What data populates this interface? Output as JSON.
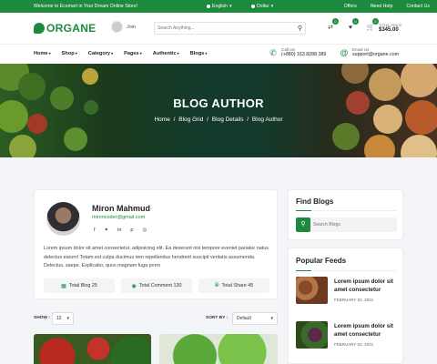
{
  "topbar": {
    "welcome": "Welcome to Ecomart in Your Dream Online Store!",
    "language": "English",
    "currency": "Dollar",
    "links": [
      "Offers",
      "Need Help",
      "Contact Us"
    ]
  },
  "header": {
    "logo": "ORGANE",
    "join": "Join",
    "search_placeholder": "Search Anything...",
    "icons": [
      {
        "name": "compare-icon",
        "badge": "0"
      },
      {
        "name": "wishlist-icon",
        "badge": "0"
      },
      {
        "name": "cart-icon",
        "badge": "0"
      }
    ],
    "total_label": "TOTAL PRICE",
    "total_value": "$345.00"
  },
  "nav": {
    "items": [
      "Home",
      "Shop",
      "Category",
      "Pages",
      "Authentic",
      "Blogs"
    ],
    "call_label": "Call Us",
    "call_value": "(+880) 163 8288 389",
    "email_label": "Email Us",
    "email_value": "support@organe.com"
  },
  "hero": {
    "title": "BLOG AUTHOR",
    "breadcrumb": [
      "Home",
      "Blog Grid",
      "Blog Details",
      "Blog Author"
    ]
  },
  "author": {
    "name": "Miron Mahmud",
    "email": "mironcoder@gmail.com",
    "social": [
      "facebook-icon",
      "twitter-icon",
      "linkedin-icon",
      "pinterest-icon",
      "instagram-icon"
    ],
    "bio": "Lorem ipsum dolor sit amet consectetur, adipisicing elit. Ea deserunt nisi tempore eveniet pariatur natus delectus earum! Totam est culpa ducimus rem repellendus hendrerit suscipit veritatis assumenda. Delectus, saepe. Explicabo, quos magnam fuga porro",
    "stats": [
      "Total Blog 25",
      "Total Comment 130",
      "Total Share 45"
    ]
  },
  "sidebar": {
    "find_title": "Find Blogs",
    "search_placeholder": "Search Blogs",
    "popular_title": "Popular Feeds",
    "feeds": [
      {
        "title": "Lorem ipsum dolor sit amet consectetur",
        "date": "FEBRUARY 02, 2021"
      },
      {
        "title": "Lorem ipsum dolor sit amet consectetur",
        "date": "FEBRUARY 02, 2021"
      }
    ]
  },
  "listing": {
    "show_label": "SHOW :",
    "show_value": "12",
    "sort_label": "SORT BY :",
    "sort_value": "Default"
  },
  "colors": {
    "accent": "#1d8a3d"
  }
}
